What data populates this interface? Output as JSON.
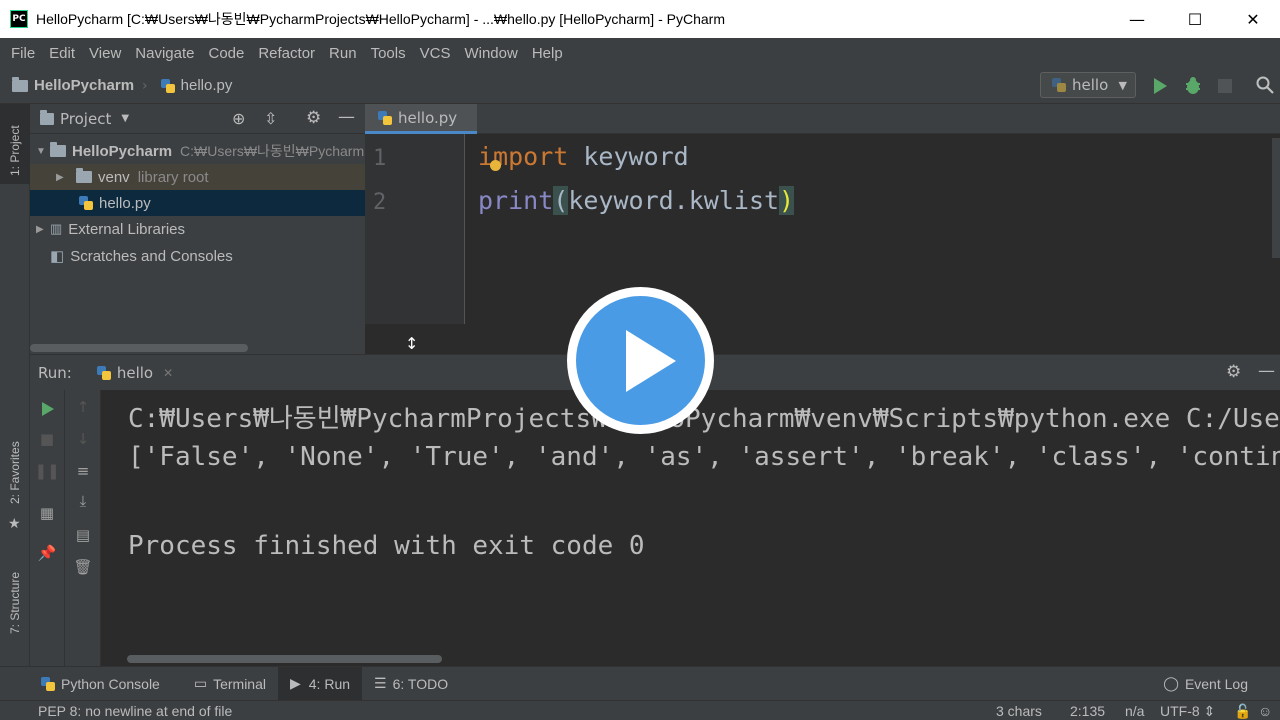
{
  "window": {
    "title": "HelloPycharm [C:₩Users₩나동빈₩PycharmProjects₩HelloPycharm] - ...₩hello.py [HelloPycharm] - PyCharm",
    "app_icon_text": "PC",
    "minimize": "—",
    "maximize": "☐",
    "close": "✕"
  },
  "menu": [
    "File",
    "Edit",
    "View",
    "Navigate",
    "Code",
    "Refactor",
    "Run",
    "Tools",
    "VCS",
    "Window",
    "Help"
  ],
  "navbar": {
    "project": "HelloPycharm",
    "file": "hello.py",
    "run_config": "hello"
  },
  "left_strip": {
    "project_tab": "1: Project",
    "favorites_tab": "2: Favorites",
    "structure_tab": "7: Structure"
  },
  "project_panel": {
    "header": "Project",
    "root_name": "HelloPycharm",
    "root_path": "C:₩Users₩나동빈₩Pycharm",
    "venv": "venv",
    "venv_note": "library root",
    "file": "hello.py",
    "external": "External Libraries",
    "scratches": "Scratches and Consoles"
  },
  "editor": {
    "tab": "hello.py",
    "line_numbers": [
      "1",
      "2"
    ],
    "line1_kw": "import",
    "line1_rest": " keyword",
    "line2_builtin": "print",
    "line2_open": "(",
    "line2_mid": "keyword.kwlist",
    "line2_close": ")"
  },
  "run_panel": {
    "label": "Run:",
    "tab": "hello",
    "console": [
      "C:₩Users₩나동빈₩PycharmProjects₩HelloPycharm₩venv₩Scripts₩python.exe C:/Users",
      "['False', 'None', 'True', 'and', 'as', 'assert', 'break', 'class', 'continue'",
      "",
      "Process finished with exit code 0"
    ]
  },
  "bottom_tabs": {
    "python_console": "Python Console",
    "terminal": "Terminal",
    "run": "4: Run",
    "todo": "6: TODO",
    "event_log": "Event Log"
  },
  "status": {
    "message": "PEP 8: no newline at end of file",
    "chars": "3 chars",
    "position": "2:135",
    "na": "n/a",
    "encoding": "UTF-8 ⇕"
  },
  "colors": {
    "accent": "#4a88c7",
    "play_button": "#4a9be6",
    "run_green": "#59a869",
    "keyword": "#cc7832"
  }
}
